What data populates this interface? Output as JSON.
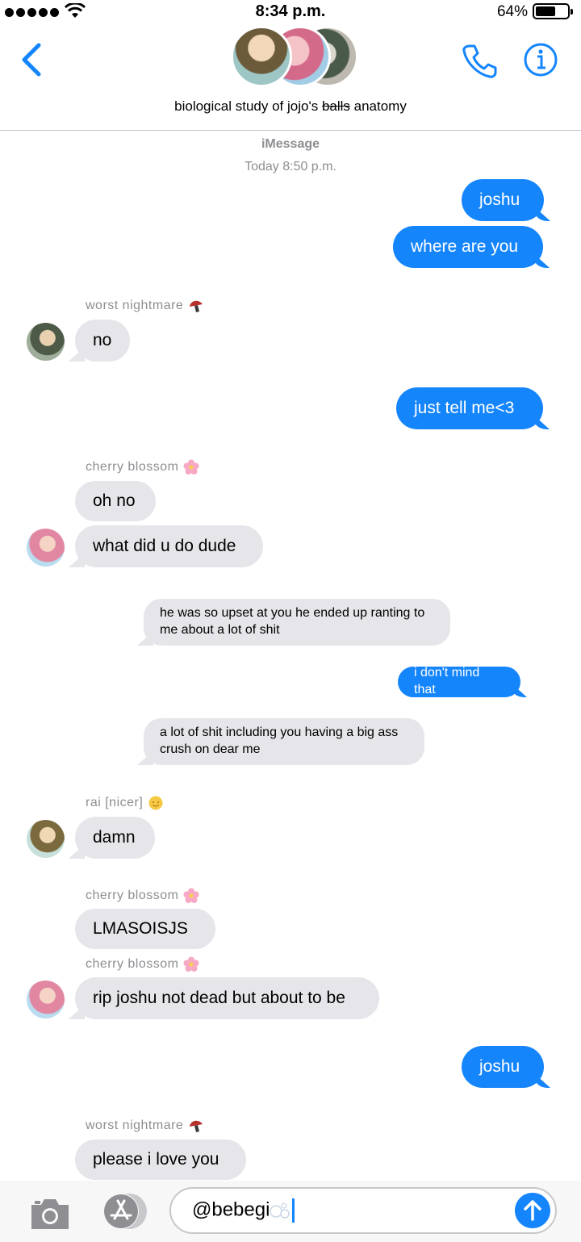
{
  "status_bar": {
    "time": "8:34 p.m.",
    "battery_percent": "64%",
    "battery_level": 0.64
  },
  "header": {
    "group_name_prefix": "biological study of jojo's ",
    "group_name_struck": "balls",
    "group_name_suffix": " anatomy"
  },
  "conversation": {
    "service": "iMessage",
    "timestamp": "Today 8:50 p.m."
  },
  "messages": [
    {
      "direction": "out",
      "text": "joshu"
    },
    {
      "direction": "out",
      "text": "where are you"
    },
    {
      "direction": "in",
      "sender": "worst nightmare",
      "sender_emoji": "mushroom-icon",
      "text": "no"
    },
    {
      "direction": "out",
      "text": "just tell me<3"
    },
    {
      "direction": "in",
      "sender": "cherry blossom",
      "sender_emoji": "cherry-blossom-icon",
      "text": "oh no"
    },
    {
      "direction": "in",
      "text": "what did u do dude"
    },
    {
      "direction": "in",
      "screenshot": true,
      "text": "he was so upset at you he ended up ranting to me about a lot of shit"
    },
    {
      "direction": "out",
      "screenshot": true,
      "text": "i don't mind that"
    },
    {
      "direction": "in",
      "screenshot": true,
      "text": "a lot of shit including you having a big ass crush on dear me"
    },
    {
      "direction": "in",
      "sender": "rai [nicer]",
      "sender_emoji": "sun-face-icon",
      "text": "damn"
    },
    {
      "direction": "in",
      "sender": "cherry blossom",
      "sender_emoji": "cherry-blossom-icon",
      "text": "LMASOISJS"
    },
    {
      "direction": "in",
      "sender": "cherry blossom",
      "sender_emoji": "cherry-blossom-icon",
      "text": "rip joshu not dead but about to be"
    },
    {
      "direction": "out",
      "text": "joshu"
    },
    {
      "direction": "in",
      "sender": "worst nightmare",
      "sender_emoji": "mushroom-icon",
      "text": "please i love you"
    }
  ],
  "input": {
    "value": "@bebegi"
  },
  "colors": {
    "accent": "#1585fc",
    "incoming_bubble": "#e5e5ea",
    "meta_text": "#8e8e93"
  }
}
